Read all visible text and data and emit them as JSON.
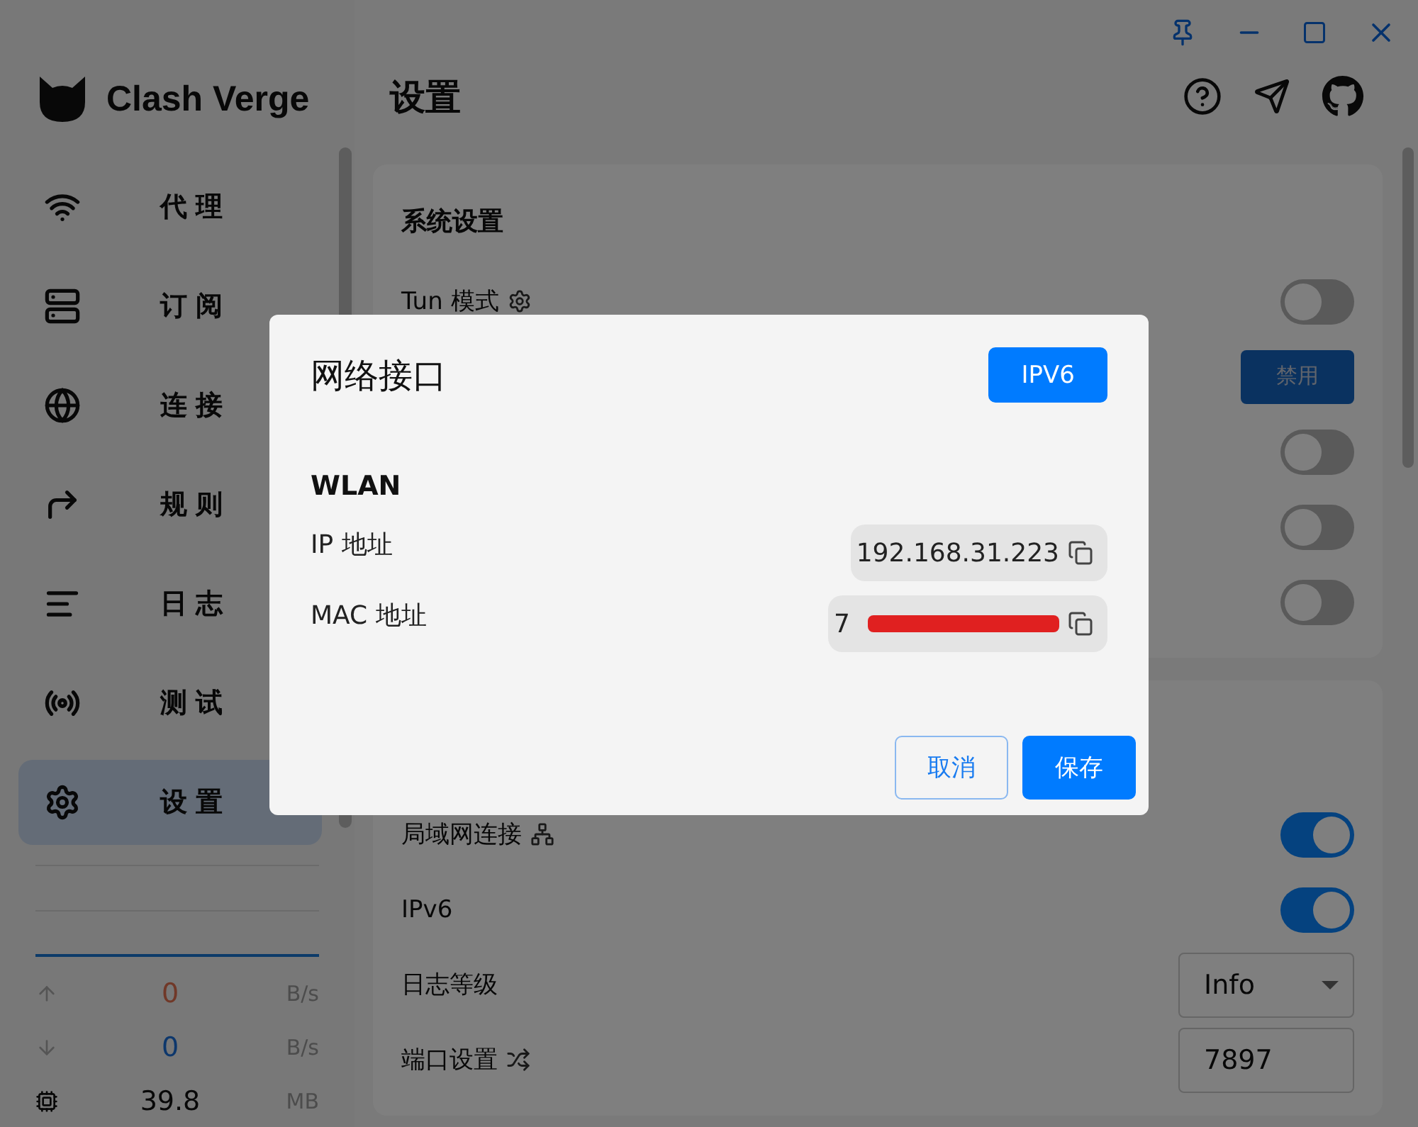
{
  "app": {
    "name": "Clash Verge"
  },
  "sidebar": {
    "items": [
      {
        "label": "代理",
        "selected": false
      },
      {
        "label": "订阅",
        "selected": false
      },
      {
        "label": "连接",
        "selected": false
      },
      {
        "label": "规则",
        "selected": false
      },
      {
        "label": "日志",
        "selected": false
      },
      {
        "label": "测试",
        "selected": false
      },
      {
        "label": "设置",
        "selected": true
      }
    ],
    "stats": [
      {
        "kind": "upload",
        "value": "0",
        "unit": "B/s"
      },
      {
        "kind": "download",
        "value": "0",
        "unit": "B/s"
      },
      {
        "kind": "memory",
        "value": "39.8",
        "unit": "MB"
      }
    ]
  },
  "header": {
    "title": "设置"
  },
  "cards": [
    {
      "title": "系统设置",
      "rows": [
        {
          "kind": "switch",
          "label": "Tun 模式",
          "on": false
        },
        {
          "kind": "button",
          "button": "禁用"
        },
        {
          "kind": "switch",
          "on": false
        },
        {
          "kind": "switch",
          "on": false
        },
        {
          "kind": "switch",
          "on": false
        }
      ]
    },
    {
      "rows": [
        {
          "kind": "switch",
          "label": "局域网连接",
          "on": true
        },
        {
          "kind": "switch",
          "label": "IPv6",
          "on": true
        },
        {
          "kind": "select",
          "label": "日志等级",
          "value": "Info"
        },
        {
          "kind": "input",
          "label": "端口设置",
          "value": "7897"
        }
      ]
    }
  ],
  "dialog": {
    "title": "网络接口",
    "toggle_button": "IPV6",
    "interface": "WLAN",
    "fields": [
      {
        "label": "IP 地址",
        "value": "192.168.31.223",
        "redacted": false
      },
      {
        "label": "MAC 地址",
        "value": "7",
        "redacted": true
      }
    ],
    "buttons": [
      {
        "label": "取消",
        "kind": "outlined"
      },
      {
        "label": "保存",
        "kind": "primary"
      }
    ]
  }
}
